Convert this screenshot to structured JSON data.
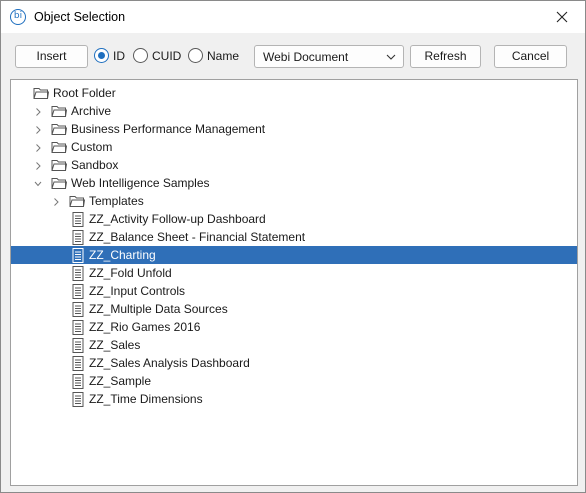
{
  "window": {
    "title": "Object Selection",
    "app_icon": "bi"
  },
  "toolbar": {
    "insert_label": "Insert",
    "radio_id_label": "ID",
    "radio_cuid_label": "CUID",
    "radio_name_label": "Name",
    "selected_radio": "ID",
    "document_type": "Webi Document",
    "refresh_label": "Refresh",
    "cancel_label": "Cancel"
  },
  "tree": {
    "items": [
      {
        "label": "Root Folder",
        "type": "folder",
        "level": 0,
        "expander": "none"
      },
      {
        "label": "Archive",
        "type": "folder",
        "level": 1,
        "expander": "collapsed"
      },
      {
        "label": "Business Performance Management",
        "type": "folder",
        "level": 1,
        "expander": "collapsed"
      },
      {
        "label": "Custom",
        "type": "folder",
        "level": 1,
        "expander": "collapsed"
      },
      {
        "label": "Sandbox",
        "type": "folder",
        "level": 1,
        "expander": "collapsed"
      },
      {
        "label": "Web Intelligence Samples",
        "type": "folder",
        "level": 1,
        "expander": "expanded"
      },
      {
        "label": "Templates",
        "type": "folder",
        "level": 2,
        "expander": "collapsed"
      },
      {
        "label": "ZZ_Activity Follow-up Dashboard",
        "type": "document",
        "level": 2,
        "expander": "none"
      },
      {
        "label": "ZZ_Balance Sheet - Financial Statement",
        "type": "document",
        "level": 2,
        "expander": "none"
      },
      {
        "label": "ZZ_Charting",
        "type": "document",
        "level": 2,
        "expander": "none",
        "selected": true
      },
      {
        "label": "ZZ_Fold Unfold",
        "type": "document",
        "level": 2,
        "expander": "none"
      },
      {
        "label": "ZZ_Input Controls",
        "type": "document",
        "level": 2,
        "expander": "none"
      },
      {
        "label": "ZZ_Multiple Data Sources",
        "type": "document",
        "level": 2,
        "expander": "none"
      },
      {
        "label": "ZZ_Rio Games 2016",
        "type": "document",
        "level": 2,
        "expander": "none"
      },
      {
        "label": "ZZ_Sales",
        "type": "document",
        "level": 2,
        "expander": "none"
      },
      {
        "label": "ZZ_Sales Analysis Dashboard",
        "type": "document",
        "level": 2,
        "expander": "none"
      },
      {
        "label": "ZZ_Sample",
        "type": "document",
        "level": 2,
        "expander": "none"
      },
      {
        "label": "ZZ_Time Dimensions",
        "type": "document",
        "level": 2,
        "expander": "none"
      }
    ]
  },
  "colors": {
    "accent": "#1f6fbf",
    "selection": "#2f6fb8"
  }
}
